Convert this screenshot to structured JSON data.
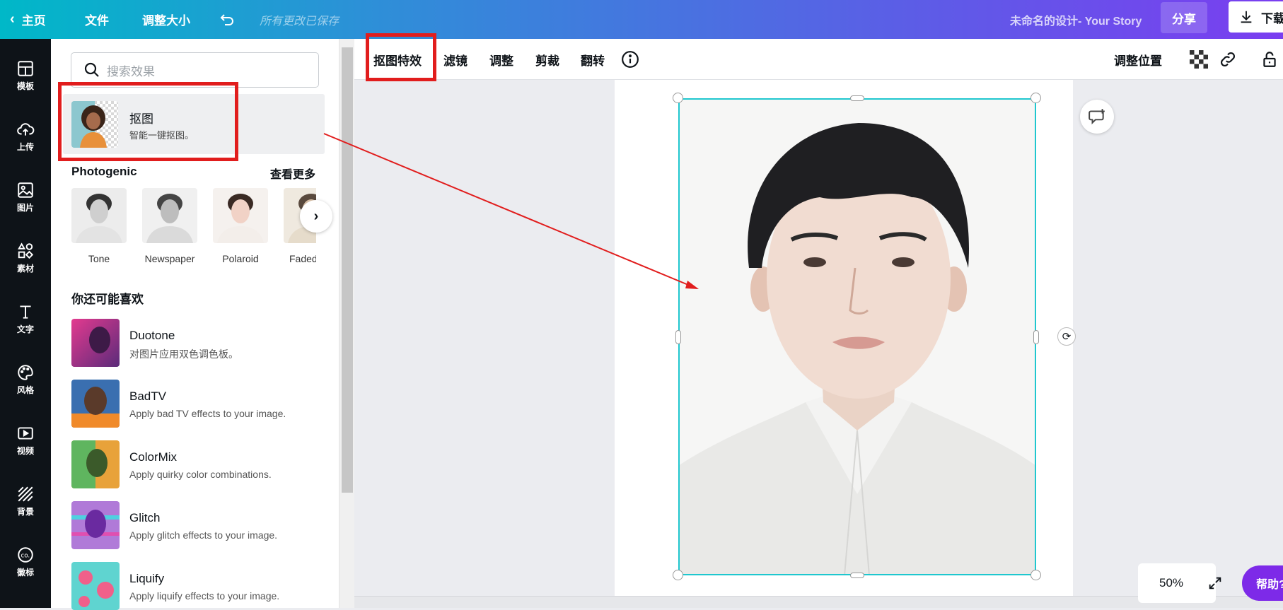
{
  "topbar": {
    "home": "主页",
    "file": "文件",
    "resize": "调整大小",
    "saved_status": "所有更改已保存",
    "design_title": "未命名的设计- Your Story",
    "share": "分享",
    "download": "下载"
  },
  "rail": {
    "items": [
      {
        "label": "模板",
        "icon": "template-icon"
      },
      {
        "label": "上传",
        "icon": "cloud-upload-icon"
      },
      {
        "label": "图片",
        "icon": "image-icon"
      },
      {
        "label": "素材",
        "icon": "elements-icon"
      },
      {
        "label": "文字",
        "icon": "text-icon"
      },
      {
        "label": "风格",
        "icon": "palette-icon"
      },
      {
        "label": "视频",
        "icon": "video-icon"
      },
      {
        "label": "背景",
        "icon": "background-icon"
      },
      {
        "label": "徽标",
        "icon": "logo-icon"
      }
    ]
  },
  "panel": {
    "search_placeholder": "搜索效果",
    "cutout": {
      "title": "抠图",
      "subtitle": "智能一键抠图。"
    },
    "photogenic": {
      "title": "Photogenic",
      "see_more": "查看更多",
      "presets": [
        "Tone",
        "Newspaper",
        "Polaroid",
        "Faded"
      ]
    },
    "suggest": {
      "title": "你还可能喜欢",
      "effects": [
        {
          "name": "Duotone",
          "desc": "对图片应用双色调色板。"
        },
        {
          "name": "BadTV",
          "desc": "Apply bad TV effects to your image."
        },
        {
          "name": "ColorMix",
          "desc": "Apply quirky color combinations."
        },
        {
          "name": "Glitch",
          "desc": "Apply glitch effects to your image."
        },
        {
          "name": "Liquify",
          "desc": "Apply liquify effects to your image."
        }
      ]
    }
  },
  "editor_toolbar": {
    "effects": "抠图特效",
    "filter": "滤镜",
    "adjust": "调整",
    "crop": "剪裁",
    "flip": "翻转",
    "position": "调整位置"
  },
  "canvas": {
    "zoom": "50%",
    "help": "帮助?"
  },
  "colors": {
    "accent_red": "#e11d1d",
    "selection": "#1fc7cf",
    "purple": "#7d2ae8"
  }
}
